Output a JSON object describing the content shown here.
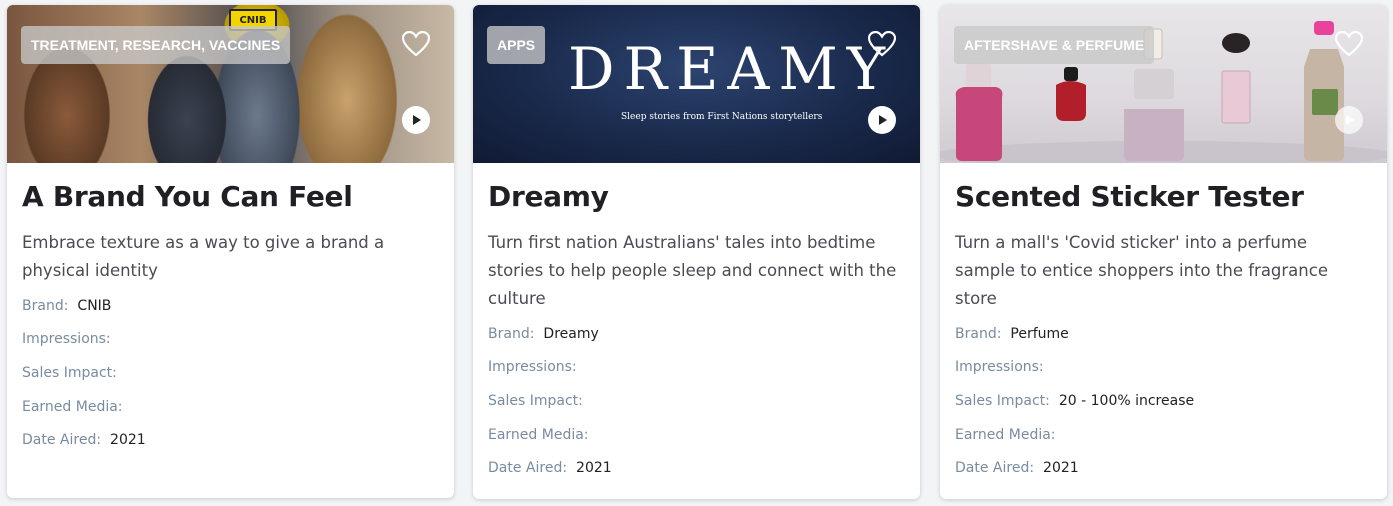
{
  "colors": {
    "title": "#1f1f24",
    "description": "#4a4c55",
    "meta_label": "#7a8ba0",
    "meta_value": "#222226",
    "tag_bg": "#c8c8c8",
    "tag_text": "#ffffff"
  },
  "icons": {
    "favorite": "heart-outline-icon",
    "video": "play-icon"
  },
  "cards": [
    {
      "tag": "TREATMENT, RESEARCH, VACCINES",
      "image_text": "CNIB",
      "title": "A Brand You Can Feel",
      "description": "Embrace texture as a way to give a brand a physical identity",
      "meta": [
        {
          "label": "Brand:",
          "value": "CNIB"
        },
        {
          "label": "Impressions:",
          "value": ""
        },
        {
          "label": "Sales Impact:",
          "value": ""
        },
        {
          "label": "Earned Media:",
          "value": ""
        },
        {
          "label": "Date Aired:",
          "value": "2021"
        }
      ]
    },
    {
      "tag": "APPS",
      "image_logo": "DREAMY",
      "image_subtitle": "Sleep stories from First Nations storytellers",
      "title": "Dreamy",
      "description": "Turn first nation Australians' tales into bedtime stories to help people sleep and connect with the culture",
      "meta": [
        {
          "label": "Brand:",
          "value": "Dreamy"
        },
        {
          "label": "Impressions:",
          "value": ""
        },
        {
          "label": "Sales Impact:",
          "value": ""
        },
        {
          "label": "Earned Media:",
          "value": ""
        },
        {
          "label": "Date Aired:",
          "value": "2021"
        }
      ]
    },
    {
      "tag": "AFTERSHAVE & PERFUME",
      "title": "Scented Sticker Tester",
      "description": "Turn a mall's 'Covid sticker' into a perfume sample to entice shoppers into the fragrance store",
      "meta": [
        {
          "label": "Brand:",
          "value": "Perfume"
        },
        {
          "label": "Impressions:",
          "value": ""
        },
        {
          "label": "Sales Impact:",
          "value": "20 - 100% increase"
        },
        {
          "label": "Earned Media:",
          "value": ""
        },
        {
          "label": "Date Aired:",
          "value": "2021"
        }
      ]
    }
  ]
}
